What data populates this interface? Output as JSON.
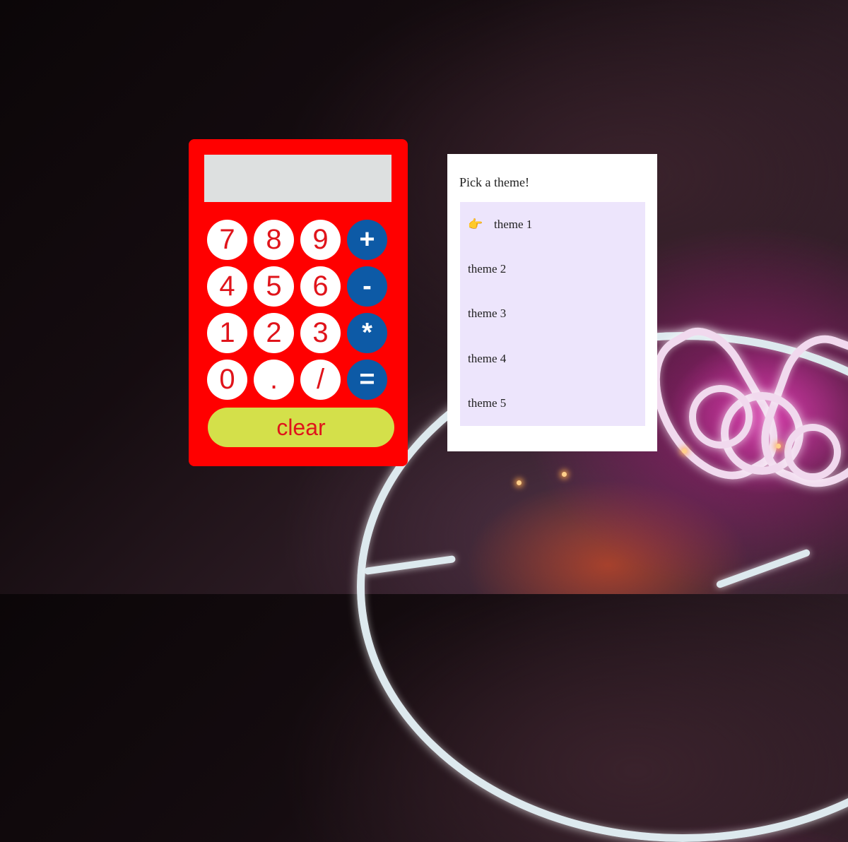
{
  "calculator": {
    "display_value": "",
    "keys": [
      {
        "label": "7",
        "type": "number"
      },
      {
        "label": "8",
        "type": "number"
      },
      {
        "label": "9",
        "type": "number"
      },
      {
        "label": "+",
        "type": "operator"
      },
      {
        "label": "4",
        "type": "number"
      },
      {
        "label": "5",
        "type": "number"
      },
      {
        "label": "6",
        "type": "number"
      },
      {
        "label": "-",
        "type": "operator"
      },
      {
        "label": "1",
        "type": "number"
      },
      {
        "label": "2",
        "type": "number"
      },
      {
        "label": "3",
        "type": "number"
      },
      {
        "label": "*",
        "type": "operator"
      },
      {
        "label": "0",
        "type": "number"
      },
      {
        "label": ".",
        "type": "number"
      },
      {
        "label": "/",
        "type": "number"
      },
      {
        "label": "=",
        "type": "operator"
      }
    ],
    "clear_label": "clear",
    "colors": {
      "body": "#ff0000",
      "display": "#dde0e0",
      "number_key": "#ffffff",
      "number_text": "#e0141b",
      "operator_key": "#0d5aa6",
      "clear_key": "#d4e04a"
    }
  },
  "theme_picker": {
    "title": "Pick a theme!",
    "selected_indicator": "👉",
    "selected_index": 0,
    "themes": [
      "theme 1",
      "theme 2",
      "theme 3",
      "theme 4",
      "theme 5"
    ],
    "colors": {
      "list_bg": "#ede5fc",
      "panel_bg": "#ffffff"
    }
  }
}
